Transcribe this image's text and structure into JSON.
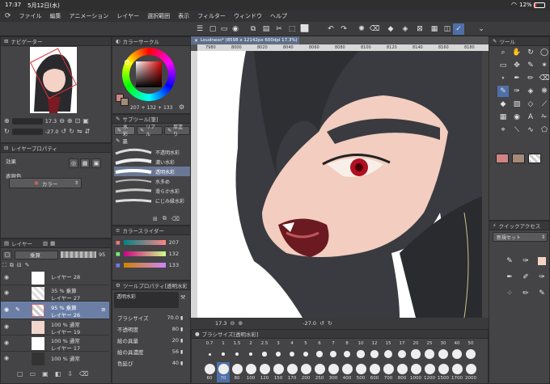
{
  "status_bar": {
    "time": "17:37",
    "date": "5月12日(水)",
    "battery": "12%"
  },
  "menu": [
    "ファイル",
    "編集",
    "アニメーション",
    "レイヤー",
    "選択範囲",
    "表示",
    "フィルター",
    "ウィンドウ",
    "ヘルプ"
  ],
  "navigator": {
    "title": "ナビゲーター",
    "zoom": "17.3",
    "angle": "-27.0"
  },
  "color_circle": {
    "title": "カラーサークル",
    "r": "207",
    "g": "132",
    "b": "133"
  },
  "sub_tool": {
    "title": "サブツール[筆]",
    "tabs": [
      "水彩",
      "リアル",
      "厚塗り"
    ],
    "group": "墨",
    "brushes": [
      "不透明水彩",
      "濃い水彩",
      "透明水彩",
      "水多め",
      "滑らか水彩",
      "にじみ縁水彩"
    ]
  },
  "layer_property": {
    "title": "レイヤープロパティ",
    "effect_label": "効果",
    "expression_label": "表現色",
    "expression_value": "カラー"
  },
  "layers": {
    "title": "レイヤー",
    "blend": "乗算",
    "opacity": "95",
    "items": [
      {
        "line1": "",
        "line2": "レイヤー 28",
        "selected": false
      },
      {
        "line1": "35 % 乗算",
        "line2": "レイヤー 27",
        "selected": false
      },
      {
        "line1": "95 % 乗算",
        "line2": "レイヤー 26",
        "selected": true
      },
      {
        "line1": "100 % 通常",
        "line2": "レイヤー 19",
        "selected": false
      },
      {
        "line1": "100 % 通常",
        "line2": "レイヤー 17",
        "selected": false
      },
      {
        "line1": "100 % 通常",
        "line2": "",
        "selected": false
      }
    ]
  },
  "color_slider": {
    "title": "カラースライダー",
    "r": "207",
    "g": "132",
    "b": "133"
  },
  "tool_property": {
    "title": "ツールプロパティ[透明水彩]",
    "tool_name": "透明水彩",
    "rows": [
      {
        "label": "ブラシサイズ",
        "value": "70.0"
      },
      {
        "label": "不透明度",
        "value": "80"
      },
      {
        "label": "絵の具量",
        "value": "20"
      },
      {
        "label": "絵の具濃度",
        "value": "56"
      },
      {
        "label": "色延び",
        "value": "40"
      }
    ]
  },
  "canvas": {
    "tab": "Loudness* (8598 x 12142px 600dpi 17.3%)",
    "ruler": [
      "7980",
      "8000",
      "8020",
      "8040",
      "8060",
      "8080",
      "8100",
      "8120",
      "8140",
      "8160",
      "8180"
    ],
    "zoom": "17.3",
    "angle": "-27.0"
  },
  "brush_size": {
    "title": "ブラシサイズ[透明水彩]",
    "top": [
      "0.7",
      "1",
      "1.5",
      "2",
      "2.5",
      "3",
      "4",
      "5",
      "6",
      "7",
      "8",
      "10",
      "12",
      "15",
      "17",
      "20",
      "25",
      "30",
      "40",
      "50"
    ],
    "bottom": [
      "60",
      "70",
      "80",
      "100",
      "120",
      "150",
      "170",
      "200",
      "250",
      "300",
      "400",
      "500",
      "600",
      "700",
      "800",
      "1000",
      "1200",
      "1500",
      "1700",
      "2000"
    ],
    "selected": "70"
  },
  "tools_title": "ツール",
  "quick_access": {
    "title": "クイックアクセス",
    "set": "新規セット"
  },
  "colors": {
    "main": "#cf8485",
    "sub": "#a48a78",
    "accent": "#4e6fa8"
  }
}
